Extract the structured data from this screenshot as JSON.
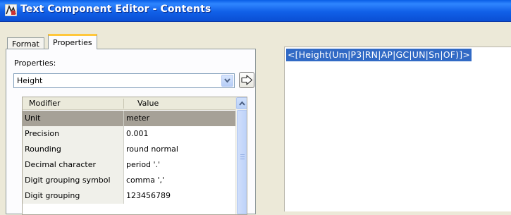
{
  "window": {
    "title": "Text Component Editor - Contents"
  },
  "tabs": [
    {
      "label": "Format"
    },
    {
      "label": "Properties"
    }
  ],
  "properties_panel": {
    "label": "Properties:",
    "selected_property": "Height",
    "grid": {
      "columns": [
        "Modifier",
        "Value"
      ],
      "rows": [
        {
          "modifier": "Unit",
          "value": "meter"
        },
        {
          "modifier": "Precision",
          "value": "0.001"
        },
        {
          "modifier": "Rounding",
          "value": "round normal"
        },
        {
          "modifier": "Decimal character",
          "value": "period '.'"
        },
        {
          "modifier": "Digit grouping symbol",
          "value": "comma ','"
        },
        {
          "modifier": "Digit grouping",
          "value": "123456789"
        }
      ],
      "selected_row_index": 0
    }
  },
  "expression": {
    "text": "<[Height(Um|P3|RN|AP|GC|UN|Sn|OF)]>"
  },
  "colors": {
    "title_bar": "#1160e8",
    "active_tab_accent": "#ffc73c",
    "selected_row": "#a6a197",
    "selection_highlight": "#316ac5"
  },
  "icons": {
    "app": "editor-icon",
    "combo": "chevron-down-icon",
    "insert": "arrow-right-icon",
    "scroll": "chevron-up-icon"
  }
}
